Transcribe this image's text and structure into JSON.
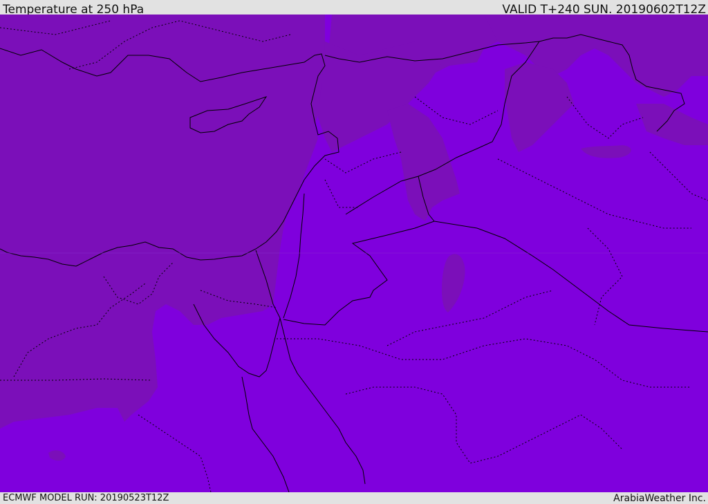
{
  "header": {
    "title": "Temperature at 250 hPa",
    "valid": "VALID T+240 SUN. 20190602T12Z"
  },
  "footer": {
    "model_run": "ECMWF MODEL RUN: 20190523T12Z",
    "credit": "ArabiaWeather Inc."
  },
  "map": {
    "colors": {
      "base_field": "#7f00dd",
      "warm_field": "#7b0fb9",
      "land_line": "#000000"
    }
  }
}
